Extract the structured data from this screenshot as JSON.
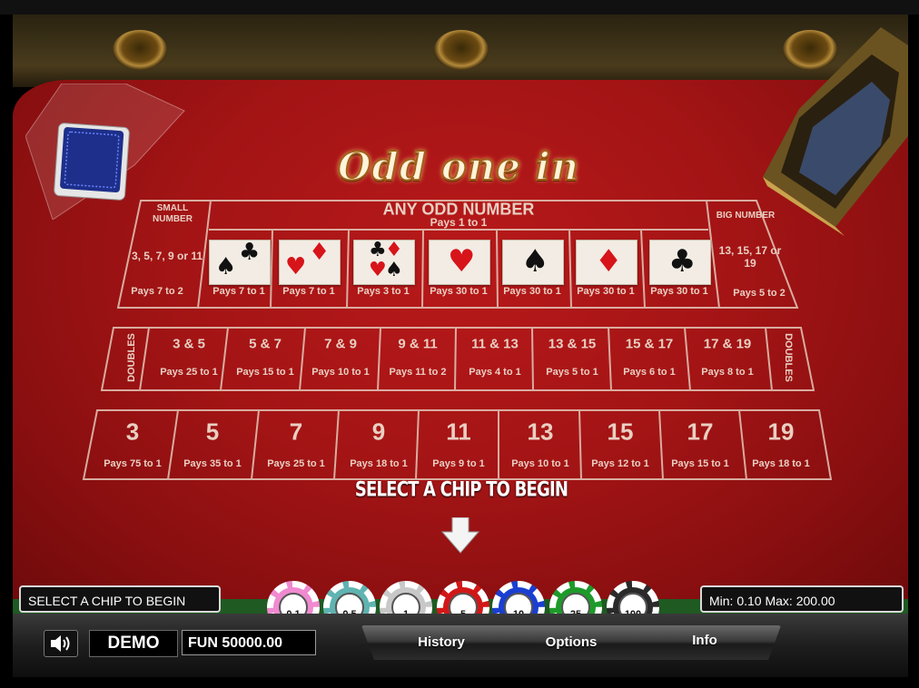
{
  "game": {
    "logo_text": "Odd one in",
    "prompt": "SELECT A CHIP TO BEGIN"
  },
  "table": {
    "small_number": {
      "label": "SMALL NUMBER",
      "numbers": "3, 5, 7, 9 or 11",
      "pays": "Pays 7 to 2"
    },
    "big_number": {
      "label": "BIG NUMBER",
      "numbers": "13, 15, 17 or 19",
      "pays": "Pays 5 to 2"
    },
    "any_odd": {
      "label": "ANY ODD NUMBER",
      "pays": "Pays 1 to 1"
    },
    "card_bets": [
      {
        "suits": [
          "spade",
          "club"
        ],
        "pays": "Pays 7 to 1"
      },
      {
        "suits": [
          "heart",
          "diamond"
        ],
        "pays": "Pays 7 to 1"
      },
      {
        "suits": [
          "club",
          "diamond",
          "heart",
          "spade"
        ],
        "pays": "Pays 3 to 1"
      },
      {
        "suits": [
          "heart"
        ],
        "pays": "Pays 30 to 1"
      },
      {
        "suits": [
          "spade"
        ],
        "pays": "Pays 30 to 1"
      },
      {
        "suits": [
          "diamond"
        ],
        "pays": "Pays 30 to 1"
      },
      {
        "suits": [
          "club"
        ],
        "pays": "Pays 30 to 1"
      }
    ],
    "doubles_label": "DOUBLES",
    "doubles": [
      {
        "label": "3 & 5",
        "pays": "Pays 25 to 1"
      },
      {
        "label": "5 & 7",
        "pays": "Pays 15 to 1"
      },
      {
        "label": "7 & 9",
        "pays": "Pays 10 to 1"
      },
      {
        "label": "9 & 11",
        "pays": "Pays 11 to 2"
      },
      {
        "label": "11 & 13",
        "pays": "Pays 4 to 1"
      },
      {
        "label": "13 & 15",
        "pays": "Pays 5 to 1"
      },
      {
        "label": "15 & 17",
        "pays": "Pays 6 to 1"
      },
      {
        "label": "17 & 19",
        "pays": "Pays 8 to 1"
      }
    ],
    "singles": [
      {
        "label": "3",
        "pays": "Pays 75 to 1"
      },
      {
        "label": "5",
        "pays": "Pays 35 to 1"
      },
      {
        "label": "7",
        "pays": "Pays 25 to 1"
      },
      {
        "label": "9",
        "pays": "Pays 18 to 1"
      },
      {
        "label": "11",
        "pays": "Pays 9 to 1"
      },
      {
        "label": "13",
        "pays": "Pays 10 to 1"
      },
      {
        "label": "15",
        "pays": "Pays 12 to 1"
      },
      {
        "label": "17",
        "pays": "Pays 15 to 1"
      },
      {
        "label": "19",
        "pays": "Pays 18 to 1"
      }
    ]
  },
  "status": {
    "message": "SELECT A CHIP TO BEGIN",
    "limits": "Min: 0.10  Max: 200.00"
  },
  "chips": [
    {
      "value": "0.1",
      "color": "#f08ad0"
    },
    {
      "value": "0.5",
      "color": "#5fb3b0"
    },
    {
      "value": "1",
      "color": "#c8c8c8"
    },
    {
      "value": "5",
      "color": "#d11818"
    },
    {
      "value": "10",
      "color": "#1a3fd0"
    },
    {
      "value": "25",
      "color": "#1e9a2a"
    },
    {
      "value": "100",
      "color": "#2a2a2a"
    }
  ],
  "toolbar": {
    "mode": "DEMO",
    "balance": "FUN 50000.00",
    "history": "History",
    "options": "Options",
    "info": "Info"
  },
  "colors": {
    "felt": "#a31415",
    "line": "#e3c7b8",
    "bar": "#1e1e1e"
  }
}
